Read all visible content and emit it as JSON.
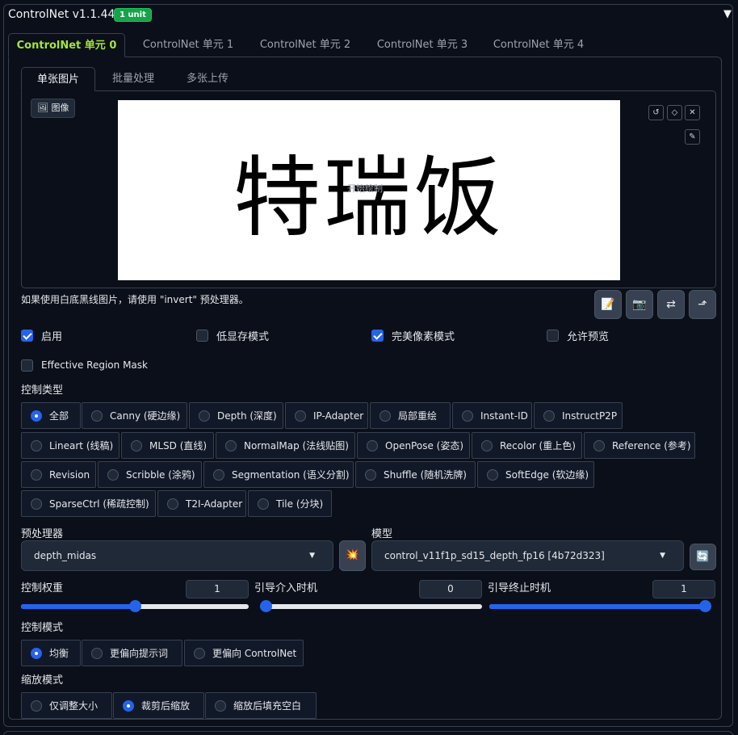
{
  "header": {
    "title": "ControlNet v1.1.449",
    "badge": "1 unit",
    "collapse_icon": "▼"
  },
  "unit_tabs": [
    "ControlNet 单元 0",
    "ControlNet 单元 1",
    "ControlNet 单元 2",
    "ControlNet 单元 3",
    "ControlNet 单元 4"
  ],
  "image_tabs": [
    "单张图片",
    "批量处理",
    "多张上传"
  ],
  "image": {
    "label": "图像",
    "canvas_text": "特瑞饭",
    "canvas_hint": "开始绘制"
  },
  "note": "如果使用白底黑线图片，请使用 \"invert\" 预处理器。",
  "checkboxes": [
    {
      "label": "启用",
      "checked": true
    },
    {
      "label": "低显存模式",
      "checked": false
    },
    {
      "label": "完美像素模式",
      "checked": true
    },
    {
      "label": "允许预览",
      "checked": false
    },
    {
      "label": "Effective Region Mask",
      "checked": false
    }
  ],
  "control_type": {
    "label": "控制类型",
    "options": [
      "全部",
      "Canny (硬边缘)",
      "Depth (深度)",
      "IP-Adapter",
      "局部重绘",
      "Instant-ID",
      "InstructP2P",
      "Lineart (线稿)",
      "MLSD (直线)",
      "NormalMap (法线贴图)",
      "OpenPose (姿态)",
      "Recolor (重上色)",
      "Reference (参考)",
      "Revision",
      "Scribble (涂鸦)",
      "Segmentation (语义分割)",
      "Shuffle (随机洗牌)",
      "SoftEdge (软边缘)",
      "SparseCtrl (稀疏控制)",
      "T2I-Adapter",
      "Tile (分块)"
    ],
    "selected": "全部"
  },
  "preprocessor": {
    "label": "预处理器",
    "value": "depth_midas"
  },
  "model": {
    "label": "模型",
    "value": "control_v11f1p_sd15_depth_fp16 [4b72d323]"
  },
  "sliders": [
    {
      "label": "控制权重",
      "value": "1",
      "fraction": 0.5
    },
    {
      "label": "引导介入时机",
      "value": "0",
      "fraction": 0.0
    },
    {
      "label": "引导终止时机",
      "value": "1",
      "fraction": 1.0
    }
  ],
  "control_mode": {
    "label": "控制模式",
    "options": [
      "均衡",
      "更偏向提示词",
      "更偏向 ControlNet"
    ],
    "selected": "均衡"
  },
  "resize_mode": {
    "label": "缩放模式",
    "options": [
      "仅调整大小",
      "裁剪后缩放",
      "缩放后填充空白"
    ],
    "selected": "裁剪后缩放"
  },
  "icons": {
    "undo": "undo-icon",
    "erase": "eraser-icon",
    "close": "close-icon",
    "brush": "brush-icon",
    "doc": "document-icon",
    "camera": "camera-icon",
    "swap": "swap-icon",
    "send": "send-icon",
    "explode": "explode-icon",
    "refresh": "refresh-icon"
  },
  "colors": {
    "accent": "#2563eb",
    "active_tab": "#a3e635",
    "badge": "#16a34a",
    "background": "#0b0f19"
  }
}
